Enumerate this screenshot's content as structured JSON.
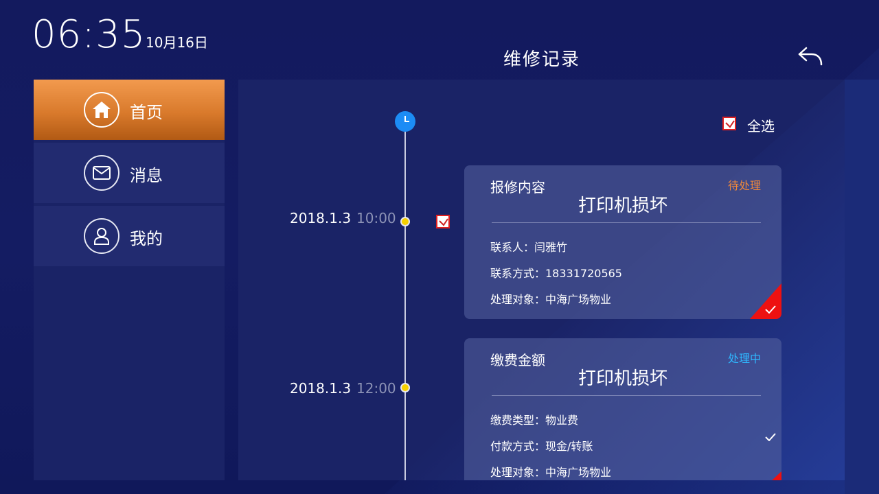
{
  "status_bar": {
    "time": "06:35",
    "date": "10月16日"
  },
  "header": {
    "title": "维修记录",
    "back_icon": "back-arrow-icon"
  },
  "sidebar": {
    "items": [
      {
        "label": "首页",
        "icon": "home-icon",
        "active": true
      },
      {
        "label": "消息",
        "icon": "mail-icon",
        "active": false
      },
      {
        "label": "我的",
        "icon": "user-icon",
        "active": false
      }
    ]
  },
  "main": {
    "select_all_label": "全选",
    "records": [
      {
        "date": "2018.1.3",
        "time": "10:00",
        "type": "报修内容",
        "status": "待处理",
        "status_color": "#f0883a",
        "title": "打印机损坏",
        "rows": [
          "联系人：闫雅竹",
          "联系方式：18331720565",
          "处理对象：中海广场物业"
        ]
      },
      {
        "date": "2018.1.3",
        "time": "12:00",
        "type": "缴费金额",
        "status": "处理中",
        "status_color": "#2fb8ff",
        "title": "打印机损坏",
        "rows": [
          "缴费类型：物业费",
          "付款方式：现金/转账",
          "处理对象：中海广场物业"
        ]
      }
    ]
  },
  "colors": {
    "accent_orange": "#e0832f",
    "alert_red": "#ee1111",
    "timeline_blue": "#1c8cf5"
  }
}
